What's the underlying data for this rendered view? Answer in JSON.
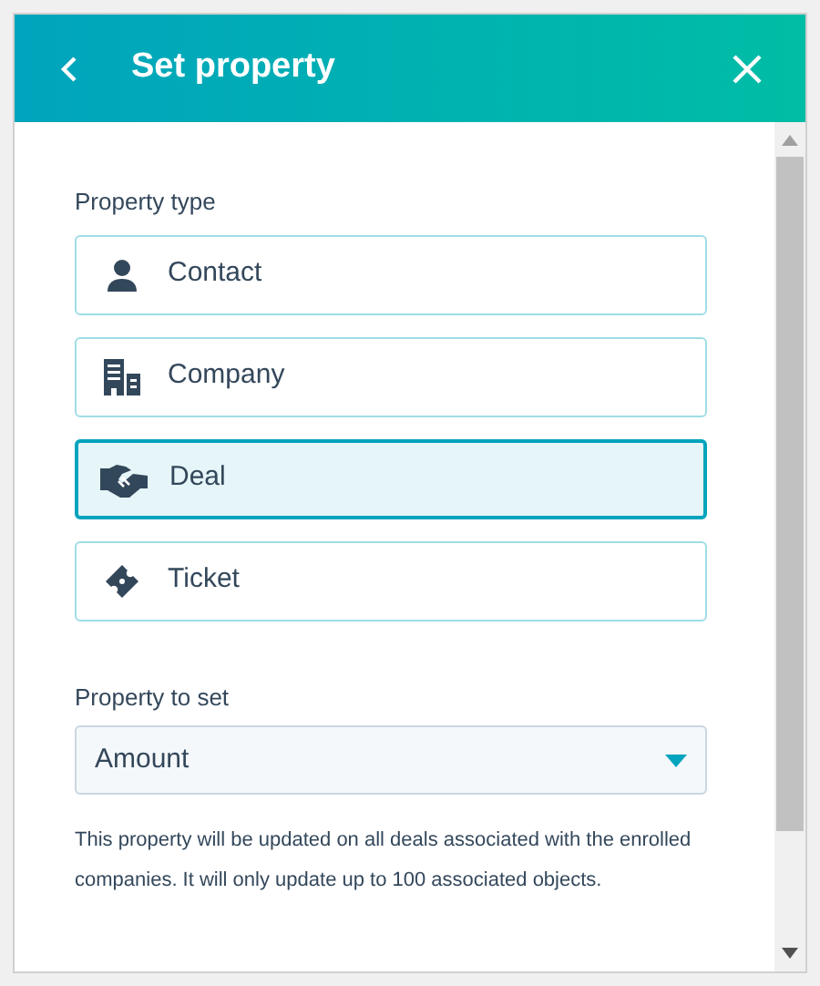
{
  "header": {
    "title": "Set property"
  },
  "property_type": {
    "label": "Property type",
    "options": [
      {
        "label": "Contact",
        "kind": "contact",
        "selected": false
      },
      {
        "label": "Company",
        "kind": "company",
        "selected": false
      },
      {
        "label": "Deal",
        "kind": "deal",
        "selected": true
      },
      {
        "label": "Ticket",
        "kind": "ticket",
        "selected": false
      }
    ]
  },
  "property_to_set": {
    "label": "Property to set",
    "value": "Amount"
  },
  "help_text": "This property will be updated on all deals associated with the enrolled companies. It will only update up to 100 associated objects."
}
